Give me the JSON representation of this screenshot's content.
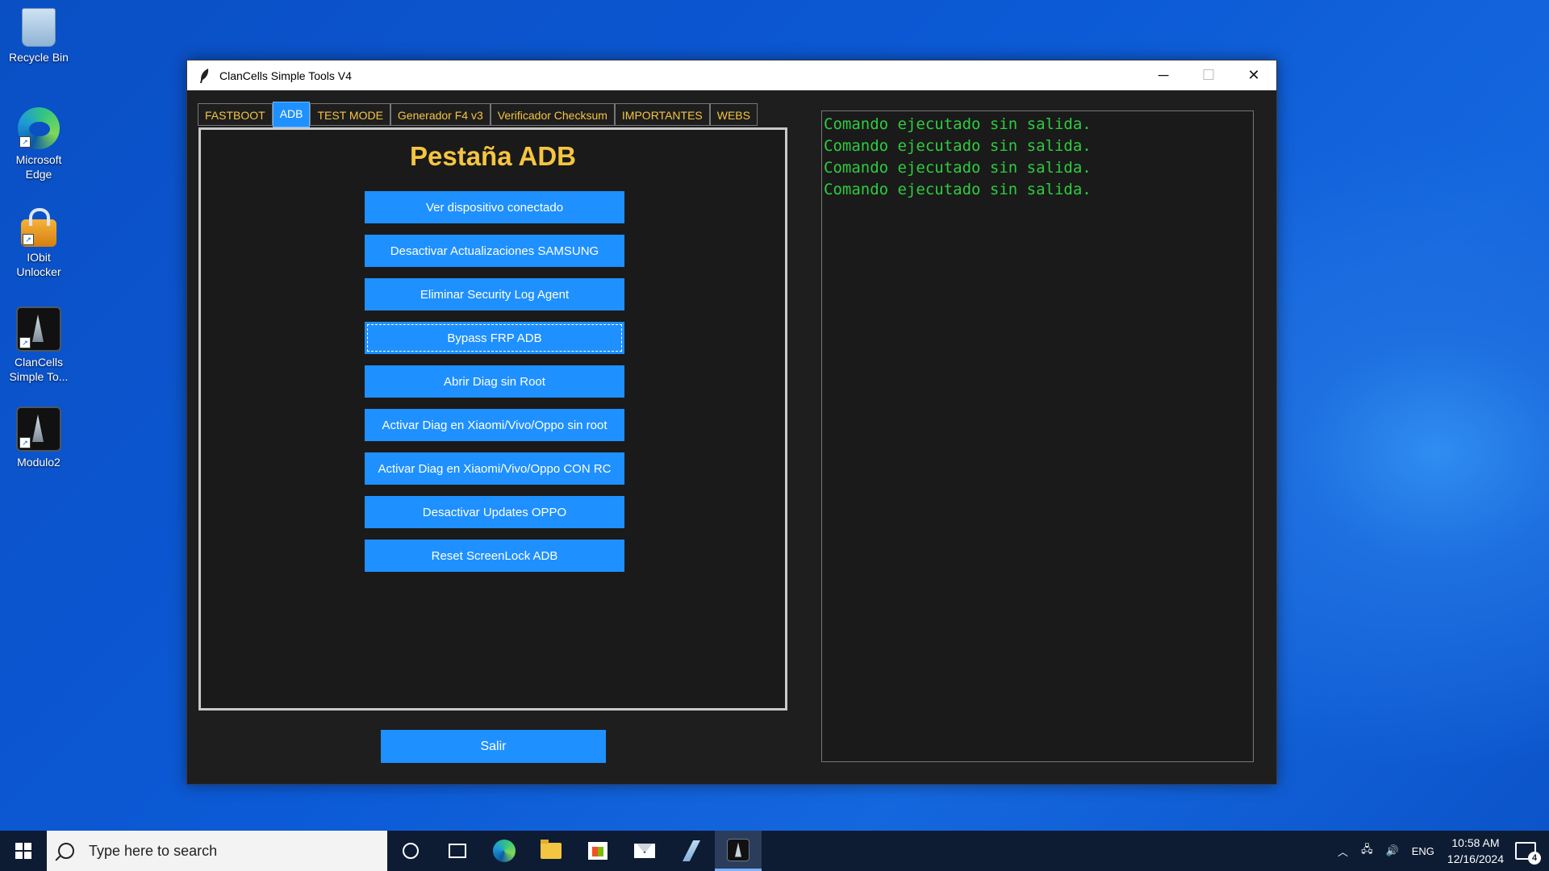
{
  "desktop": {
    "icons": [
      {
        "label": "Recycle Bin"
      },
      {
        "label": "Microsoft Edge"
      },
      {
        "label": "IObit Unlocker"
      },
      {
        "label": "ClanCells Simple To..."
      },
      {
        "label": "Modulo2"
      }
    ]
  },
  "window": {
    "title": "ClanCells Simple Tools V4",
    "controls": {
      "minimize": "─",
      "maximize": "☐",
      "close": "✕"
    },
    "tabs": [
      {
        "label": "FASTBOOT"
      },
      {
        "label": "ADB",
        "active": true
      },
      {
        "label": "TEST MODE"
      },
      {
        "label": "Generador F4 v3"
      },
      {
        "label": "Verificador Checksum"
      },
      {
        "label": "IMPORTANTES"
      },
      {
        "label": "WEBS"
      }
    ],
    "panel_title": "Pestaña ADB",
    "buttons": [
      {
        "label": "Ver dispositivo conectado"
      },
      {
        "label": "Desactivar Actualizaciones SAMSUNG"
      },
      {
        "label": "Eliminar Security Log Agent"
      },
      {
        "label": "Bypass FRP ADB",
        "focused": true
      },
      {
        "label": "Abrir Diag sin Root"
      },
      {
        "label": "Activar Diag en Xiaomi/Vivo/Oppo sin root"
      },
      {
        "label": "Activar Diag en Xiaomi/Vivo/Oppo CON RC"
      },
      {
        "label": "Desactivar Updates OPPO"
      },
      {
        "label": "Reset ScreenLock ADB"
      }
    ],
    "exit_label": "Salir",
    "console_lines": [
      "Comando ejecutado sin salida.",
      "Comando ejecutado sin salida.",
      "Comando ejecutado sin salida.",
      "Comando ejecutado sin salida."
    ],
    "colors": {
      "accent": "#1f90ff",
      "tab_text": "#f5c542",
      "console_text": "#2ecc40",
      "background": "#1e1e1e"
    }
  },
  "taskbar": {
    "search_placeholder": "Type here to search",
    "language": "ENG",
    "time": "10:58 AM",
    "date": "12/16/2024",
    "notifications": "4"
  }
}
